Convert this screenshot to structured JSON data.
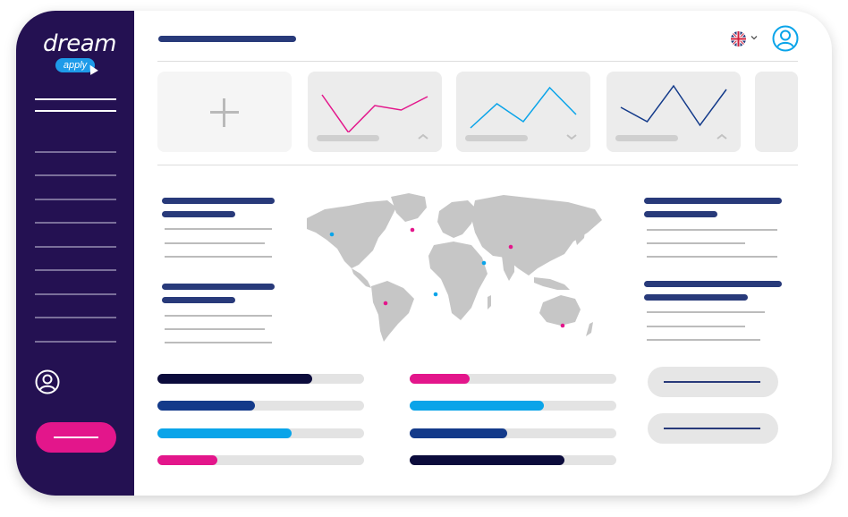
{
  "logo": {
    "word": "dream",
    "badge": "apply"
  },
  "colors": {
    "sidebar": "#241152",
    "navy": "#0c0c3c",
    "dark_blue": "#133a8a",
    "sky_blue": "#0aa4e9",
    "pink": "#e3168b",
    "grey": "#e3e3e3"
  },
  "icons": {
    "language": "uk-flag-icon",
    "account": "user-circle-icon",
    "add": "plus-icon",
    "expand": "chevron-up-icon",
    "collapse": "chevron-down-icon"
  },
  "cards": [
    {
      "type": "add"
    },
    {
      "type": "chart",
      "color": "#e3168b",
      "points": [
        18,
        60,
        30,
        35,
        20
      ],
      "toggle": "up"
    },
    {
      "type": "chart",
      "color": "#0aa4e9",
      "points": [
        55,
        28,
        48,
        10,
        40
      ],
      "toggle": "down"
    },
    {
      "type": "chart",
      "color": "#133a8a",
      "points": [
        32,
        48,
        8,
        52,
        12
      ],
      "toggle": "up"
    }
  ],
  "progress_left": [
    {
      "value": 0.75,
      "color": "#0c0c3c"
    },
    {
      "value": 0.47,
      "color": "#133a8a"
    },
    {
      "value": 0.65,
      "color": "#0aa4e9"
    },
    {
      "value": 0.29,
      "color": "#e3168b"
    }
  ],
  "progress_right": [
    {
      "value": 0.29,
      "color": "#e3168b"
    },
    {
      "value": 0.65,
      "color": "#0aa4e9"
    },
    {
      "value": 0.47,
      "color": "#133a8a"
    },
    {
      "value": 0.75,
      "color": "#0c0c3c"
    }
  ],
  "map_markers": [
    {
      "color": "#0aa4e9",
      "region": "north-america"
    },
    {
      "color": "#e3168b",
      "region": "greenland"
    },
    {
      "color": "#e3168b",
      "region": "south-america"
    },
    {
      "color": "#0aa4e9",
      "region": "west-africa"
    },
    {
      "color": "#0aa4e9",
      "region": "central-asia"
    },
    {
      "color": "#e3168b",
      "region": "siberia"
    },
    {
      "color": "#e3168b",
      "region": "australia"
    }
  ]
}
